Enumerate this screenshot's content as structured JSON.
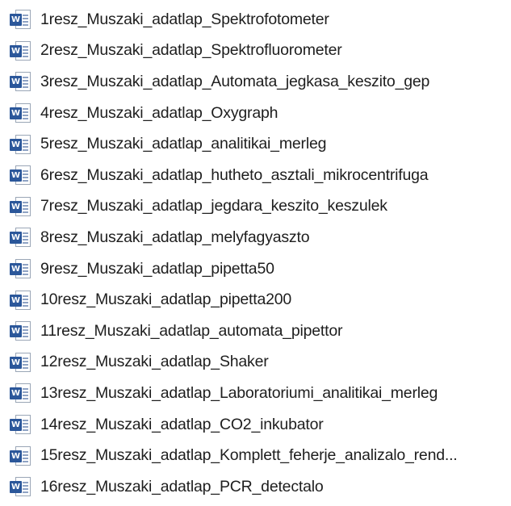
{
  "file_list": {
    "icon": "word-document-icon",
    "icon_badge_letter": "W",
    "icon_color": "#2b579a",
    "items": [
      {
        "name": "1resz_Muszaki_adatlap_Spektrofotometer"
      },
      {
        "name": "2resz_Muszaki_adatlap_Spektrofluorometer"
      },
      {
        "name": "3resz_Muszaki_adatlap_Automata_jegkasa_keszito_gep"
      },
      {
        "name": "4resz_Muszaki_adatlap_Oxygraph"
      },
      {
        "name": "5resz_Muszaki_adatlap_analitikai_merleg"
      },
      {
        "name": "6resz_Muszaki_adatlap_hutheto_asztali_mikrocentrifuga"
      },
      {
        "name": "7resz_Muszaki_adatlap_jegdara_keszito_keszulek"
      },
      {
        "name": "8resz_Muszaki_adatlap_melyfagyaszto"
      },
      {
        "name": "9resz_Muszaki_adatlap_pipetta50"
      },
      {
        "name": "10resz_Muszaki_adatlap_pipetta200"
      },
      {
        "name": "11resz_Muszaki_adatlap_automata_pipettor"
      },
      {
        "name": "12resz_Muszaki_adatlap_Shaker"
      },
      {
        "name": "13resz_Muszaki_adatlap_Laboratoriumi_analitikai_merleg"
      },
      {
        "name": "14resz_Muszaki_adatlap_CO2_inkubator"
      },
      {
        "name": "15resz_Muszaki_adatlap_Komplett_feherje_analizalo_rend..."
      },
      {
        "name": "16resz_Muszaki_adatlap_PCR_detectalo"
      }
    ]
  }
}
